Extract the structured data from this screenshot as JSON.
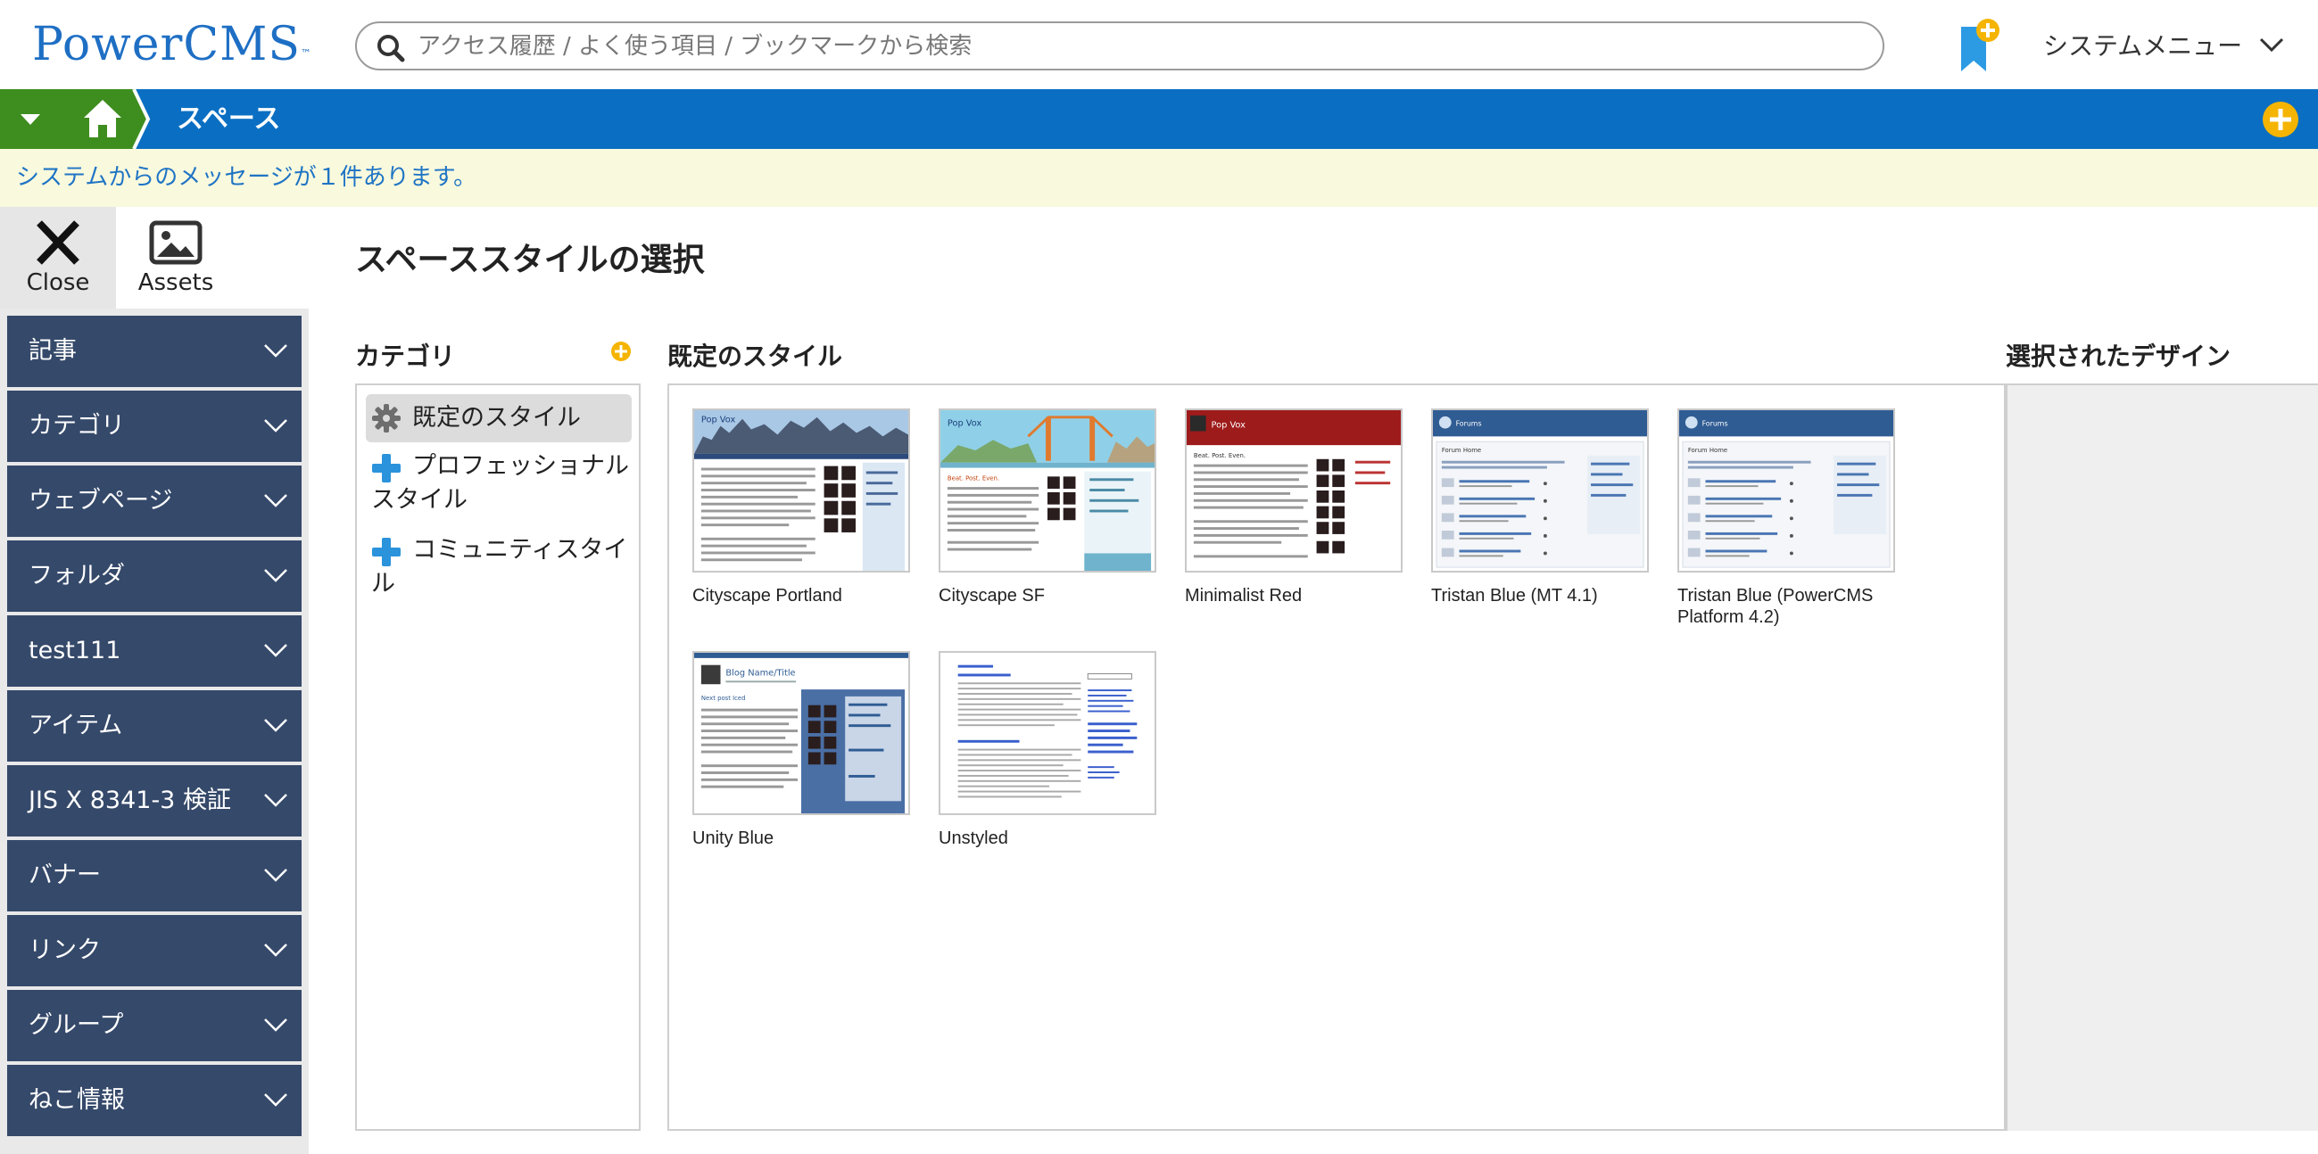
{
  "app": {
    "logo": "PowerCMS",
    "logo_mark": "™"
  },
  "header": {
    "search_placeholder": "アクセス履歴 / よく使う項目 / ブックマークから検索",
    "system_menu_label": "システムメニュー",
    "icons": {
      "search": "search-icon",
      "bookmark": "bookmark-add-icon",
      "menu": "chevron-down-icon"
    }
  },
  "nav": {
    "title": "スペース",
    "icons": {
      "caret": "caret-down-icon",
      "home": "home-icon",
      "add": "plus-circle-icon"
    }
  },
  "message_bar": {
    "text": "システムからのメッセージが１件あります。"
  },
  "tools": {
    "close_label": "Close",
    "assets_label": "Assets"
  },
  "sidebar": {
    "items": [
      {
        "label": "記事"
      },
      {
        "label": "カテゴリ"
      },
      {
        "label": "ウェブページ"
      },
      {
        "label": "フォルダ"
      },
      {
        "label": "test111"
      },
      {
        "label": "アイテム"
      },
      {
        "label": "JIS X 8341-3 検証"
      },
      {
        "label": "バナー"
      },
      {
        "label": "リンク"
      },
      {
        "label": "グループ"
      },
      {
        "label": "ねこ情報"
      }
    ]
  },
  "main": {
    "title": "スペーススタイルの選択",
    "categories_heading": "カテゴリ",
    "styles_heading": "既定のスタイル",
    "selected_heading": "選択されたデザイン",
    "categories": [
      {
        "label": "既定のスタイル",
        "icon": "gear-icon",
        "selected": true
      },
      {
        "label": "プロフェッショナルスタイル",
        "icon": "plus-icon",
        "selected": false
      },
      {
        "label": "コミュニティスタイル",
        "icon": "plus-icon",
        "selected": false
      }
    ],
    "styles": [
      {
        "label": "Cityscape Portland"
      },
      {
        "label": "Cityscape SF"
      },
      {
        "label": "Minimalist Red"
      },
      {
        "label": "Tristan Blue (MT 4.1)"
      },
      {
        "label": "Tristan Blue (PowerCMS Platform 4.2)"
      },
      {
        "label": "Unity Blue"
      },
      {
        "label": "Unstyled"
      }
    ]
  },
  "colors": {
    "brand": "#1e6fc4",
    "navbar": "#0a6fc2",
    "home_green": "#3e8e1f",
    "sidebar_item": "#35496a",
    "add_yellow": "#f5b400",
    "message_bg": "#f9f9dd"
  }
}
